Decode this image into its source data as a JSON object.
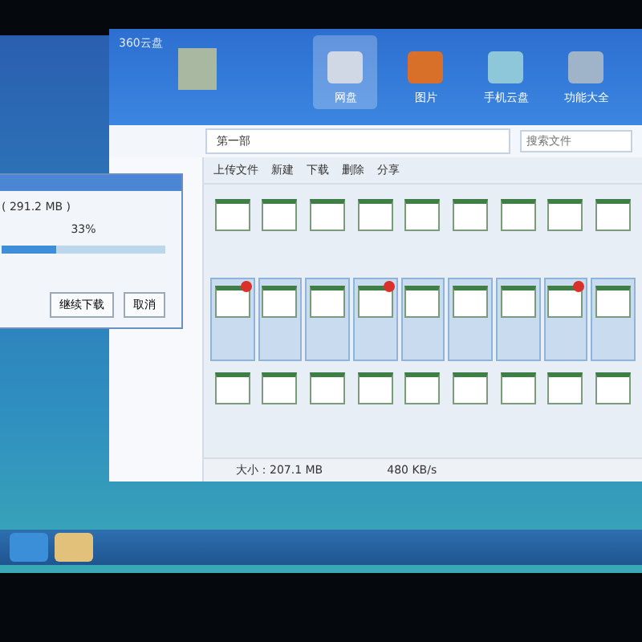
{
  "window": {
    "title": "360云盘"
  },
  "nav_tabs": [
    {
      "label": "网盘",
      "selected": true
    },
    {
      "label": "图片",
      "selected": false
    },
    {
      "label": "手机云盘",
      "selected": false
    },
    {
      "label": "功能大全",
      "selected": false
    }
  ],
  "breadcrumb": [
    "第一部"
  ],
  "search": {
    "placeholder": "搜索文件"
  },
  "toolbar": [
    "上传文件",
    "新建",
    "下载",
    "删除",
    "分享"
  ],
  "files": [
    {
      "selected": false,
      "badge": false
    },
    {
      "selected": false,
      "badge": false
    },
    {
      "selected": false,
      "badge": false
    },
    {
      "selected": false,
      "badge": false
    },
    {
      "selected": false,
      "badge": false
    },
    {
      "selected": false,
      "badge": false
    },
    {
      "selected": false,
      "badge": false
    },
    {
      "selected": false,
      "badge": false
    },
    {
      "selected": false,
      "badge": false
    },
    {
      "selected": true,
      "badge": true
    },
    {
      "selected": true,
      "badge": false
    },
    {
      "selected": true,
      "badge": false
    },
    {
      "selected": true,
      "badge": true
    },
    {
      "selected": true,
      "badge": false
    },
    {
      "selected": true,
      "badge": false
    },
    {
      "selected": true,
      "badge": false
    },
    {
      "selected": true,
      "badge": true
    },
    {
      "selected": true,
      "badge": false
    },
    {
      "selected": false,
      "badge": false
    },
    {
      "selected": false,
      "badge": false
    },
    {
      "selected": false,
      "badge": false
    },
    {
      "selected": false,
      "badge": false
    },
    {
      "selected": false,
      "badge": false
    },
    {
      "selected": false,
      "badge": false
    },
    {
      "selected": false,
      "badge": false
    },
    {
      "selected": false,
      "badge": false
    },
    {
      "selected": false,
      "badge": false
    }
  ],
  "dialog": {
    "size": "( 291.2 MB )",
    "percent": "33%",
    "level": 0.33,
    "buttons": [
      "继续下载",
      "取消"
    ]
  },
  "status_bar": {
    "size": "大小：207.1 MB",
    "speed": "480 KB/s"
  }
}
